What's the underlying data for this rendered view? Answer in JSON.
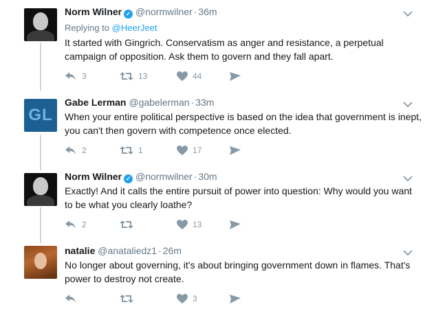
{
  "tweets": [
    {
      "name": "Norm Wilner",
      "handle": "@normwilner",
      "time": "36m",
      "verified": true,
      "replying_prefix": "Replying to",
      "replying_to": "@HeerJeet",
      "text": "It started with Gingrich. Conservatism as anger and resistance, a perpetual campaign of opposition. Ask them to govern and they fall apart.",
      "replies": "3",
      "retweets": "13",
      "likes": "44"
    },
    {
      "name": "Gabe Lerman",
      "handle": "@gabelerman",
      "time": "33m",
      "verified": false,
      "avatar_text": "GL",
      "text": "When your entire political perspective is based on the idea that government is inept, you can't then govern with competence once elected.",
      "replies": "2",
      "retweets": "1",
      "likes": "17"
    },
    {
      "name": "Norm Wilner",
      "handle": "@normwilner",
      "time": "30m",
      "verified": true,
      "text": "Exactly! And it calls the entire pursuit of power into question: Why would you want to be what you clearly loathe?",
      "replies": "2",
      "retweets": "",
      "likes": "13"
    },
    {
      "name": "natalie",
      "handle": "@anataliedz1",
      "time": "26m",
      "verified": false,
      "text": "No longer about governing, it's about bringing government down in flames. That's power to destroy not create.",
      "replies": "",
      "retweets": "",
      "likes": "3"
    }
  ],
  "icons": {
    "reply": "reply-icon",
    "retweet": "retweet-icon",
    "like": "heart-icon",
    "dm": "direct-message-icon",
    "more": "chevron-down-icon",
    "verified": "verified-badge-icon"
  },
  "colors": {
    "link": "#1da1f2",
    "muted": "#657786",
    "action_icon": "#8899a6",
    "thread_line": "#ccd6dd"
  }
}
